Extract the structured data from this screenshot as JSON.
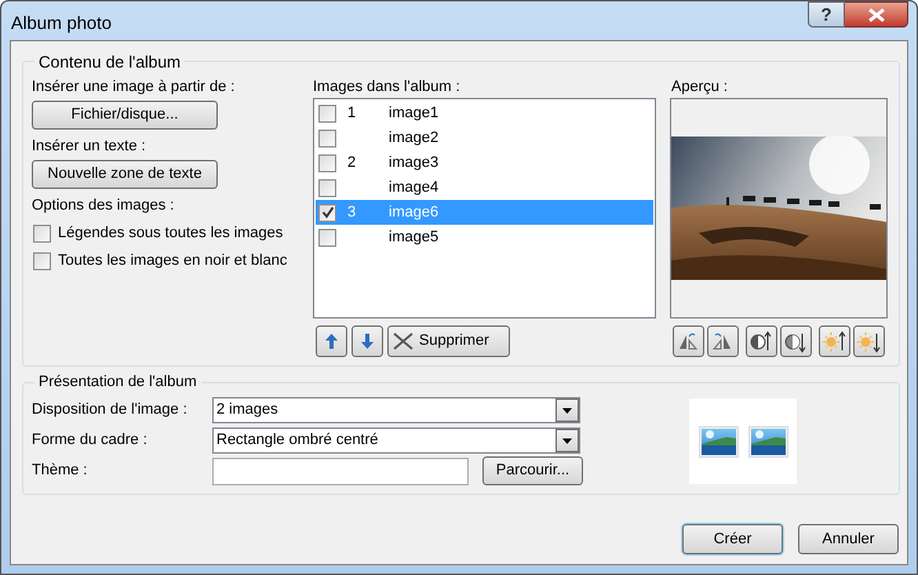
{
  "window": {
    "title": "Album photo",
    "buttons": [
      "?"
    ]
  },
  "content_group": {
    "title": "Contenu de l'album",
    "insert_image_label": "Insérer une image à partir de :",
    "file_button": "Fichier/disque...",
    "insert_text_label": "Insérer un texte :",
    "text_button": "Nouvelle zone de texte",
    "options_label": "Options des images :",
    "options": [
      {
        "label": "Légendes sous toutes les images",
        "checked": false
      },
      {
        "label": "Toutes les images en noir et blanc",
        "checked": false
      }
    ],
    "list_label": "Images dans l'album :",
    "images": [
      {
        "number": "1",
        "name": "image1",
        "checked": false,
        "selected": false
      },
      {
        "name": "image2",
        "checked": false,
        "selected": false
      },
      {
        "number": "2",
        "name": "image3",
        "checked": false,
        "selected": false
      },
      {
        "name": "image4",
        "checked": false,
        "selected": false
      },
      {
        "number": "3",
        "name": "image6",
        "checked": true,
        "selected": true
      },
      {
        "name": "image5",
        "checked": false,
        "selected": false
      }
    ],
    "delete_button": "Supprimer",
    "preview_label": "Aperçu :"
  },
  "layout_group": {
    "title": "Présentation de l'album",
    "fields": [
      {
        "kind": "select",
        "label": "Disposition de l'image :",
        "value": "2 images"
      },
      {
        "kind": "select",
        "label": "Forme du cadre :",
        "value": "Rectangle ombré centré"
      },
      {
        "kind": "text",
        "label": "Thème :",
        "button": "Parcourir..."
      }
    ]
  },
  "buttons": [
    {
      "label": "Créer",
      "default": true
    },
    {
      "label": "Annuler",
      "default": false
    }
  ]
}
